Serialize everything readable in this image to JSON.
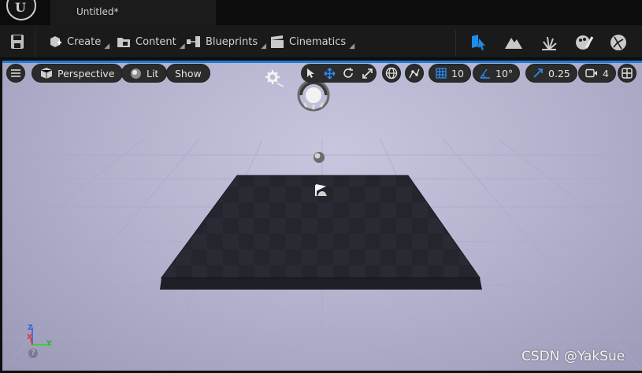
{
  "app": {
    "document_tab": "Untitled*"
  },
  "toolbar": {
    "create_label": "Create",
    "content_label": "Content",
    "blueprints_label": "Blueprints",
    "cinematics_label": "Cinematics",
    "mode_icons": [
      "select-mode-icon",
      "landscape-mode-icon",
      "foliage-mode-icon",
      "mesh-paint-mode-icon",
      "fracture-mode-icon"
    ]
  },
  "viewport": {
    "view_mode": "Perspective",
    "lighting_mode": "Lit",
    "show_label": "Show",
    "grid_snap": "10",
    "rotation_snap": "10°",
    "scale_snap": "0.25",
    "camera_speed": "4",
    "axis": {
      "z": "Z",
      "x": "X",
      "y": "Y"
    }
  },
  "watermark": "CSDN @YakSue",
  "colors": {
    "accent": "#1e7ad8",
    "viewport_bg": "#b4b4cf",
    "floor": "#2a2c35"
  }
}
